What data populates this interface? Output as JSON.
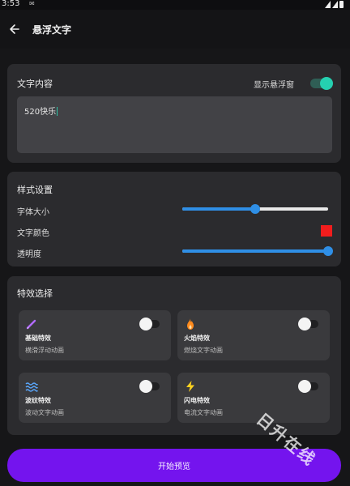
{
  "status_bar": {
    "time": "3:53",
    "notification_icon": "message-icon"
  },
  "header": {
    "title": "悬浮文字",
    "back_icon": "arrow-left-icon"
  },
  "content_card": {
    "title": "文字内容",
    "show_window_label": "显示悬浮窗",
    "show_window_on": true,
    "text_value": "520快乐"
  },
  "style_card": {
    "title": "样式设置",
    "font_size_label": "字体大小",
    "font_size_level": 0.5,
    "text_color_label": "文字颜色",
    "text_color": "#f21d1d",
    "opacity_label": "透明度",
    "opacity_level": 1.0
  },
  "effect_card": {
    "title": "特效选择",
    "items": [
      {
        "name": "基础特效",
        "desc": "横滑浮动动画",
        "icon": "pencil-icon",
        "enabled": false
      },
      {
        "name": "火焰特效",
        "desc": "燃烧文字动画",
        "icon": "flame-icon",
        "enabled": false
      },
      {
        "name": "波纹特效",
        "desc": "波动文字动画",
        "icon": "wave-icon",
        "enabled": false
      },
      {
        "name": "闪电特效",
        "desc": "电流文字动画",
        "icon": "lightning-icon",
        "enabled": false
      }
    ]
  },
  "preview_button": {
    "label": "开始预览"
  },
  "watermark": {
    "text": "日升在线"
  },
  "colors": {
    "accent": "#7414ee",
    "toggle_on": "#25d0b0",
    "slider": "#2f8fe6",
    "card": "#2b2b2e",
    "background": "#161618"
  }
}
